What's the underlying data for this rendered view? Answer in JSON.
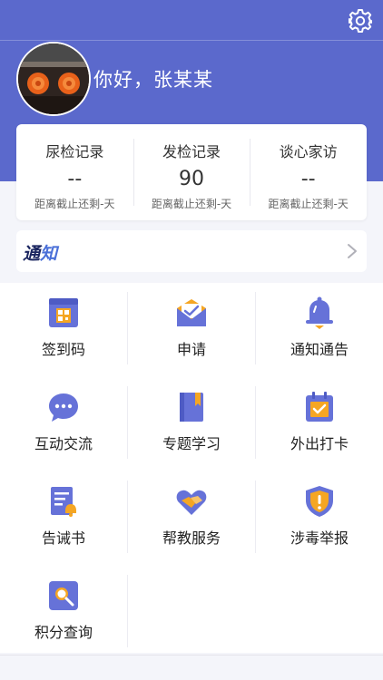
{
  "header": {
    "greeting": "你好，张某某"
  },
  "stats": [
    {
      "title": "尿检记录",
      "value": "--",
      "note": "距离截止还剩-天"
    },
    {
      "title": "发检记录",
      "value": "90",
      "note": "距离截止还剩-天"
    },
    {
      "title": "谈心家访",
      "value": "--",
      "note": "距离截止还剩-天"
    }
  ],
  "notice": {
    "label_a": "通",
    "label_b": "知"
  },
  "menu": [
    {
      "label": "签到码",
      "icon": "qr-code-icon"
    },
    {
      "label": "申请",
      "icon": "envelope-icon"
    },
    {
      "label": "通知通告",
      "icon": "bell-icon"
    },
    {
      "label": "互动交流",
      "icon": "chat-bubble-icon"
    },
    {
      "label": "专题学习",
      "icon": "book-icon"
    },
    {
      "label": "外出打卡",
      "icon": "calendar-check-icon"
    },
    {
      "label": "告诫书",
      "icon": "document-alert-icon"
    },
    {
      "label": "帮教服务",
      "icon": "handshake-heart-icon"
    },
    {
      "label": "涉毒举报",
      "icon": "shield-alert-icon"
    },
    {
      "label": "积分查询",
      "icon": "search-icon"
    }
  ],
  "colors": {
    "primary": "#5b69cc",
    "accent_orange": "#f5a623",
    "icon_purple": "#6672d8"
  }
}
